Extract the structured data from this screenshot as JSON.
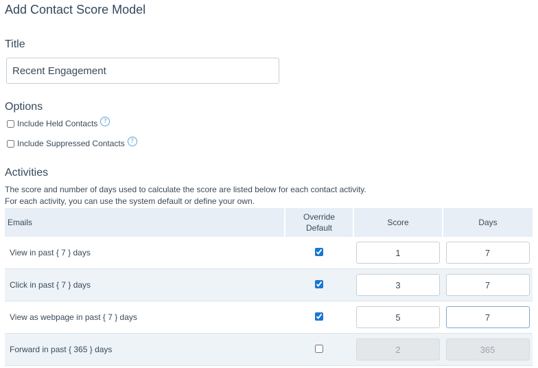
{
  "page": {
    "heading": "Add Contact Score Model"
  },
  "title_section": {
    "heading": "Title",
    "value": "Recent Engagement"
  },
  "options": {
    "heading": "Options",
    "items": [
      {
        "label": "Include Held Contacts",
        "checked": false,
        "help_icon": "question-circle-icon"
      },
      {
        "label": "Include Suppressed Contacts",
        "checked": false,
        "help_icon": "question-circle-icon"
      }
    ]
  },
  "activities": {
    "heading": "Activities",
    "description_1": "The score and number of days used to calculate the score are listed below for each contact activity.",
    "description_2": "For each activity, you can use the system default or define your own.",
    "table": {
      "headers": {
        "emails": "Emails",
        "override_line1": "Override",
        "override_line2": "Default",
        "score": "Score",
        "days": "Days"
      },
      "rows": [
        {
          "label": "View in past { 7 } days",
          "override": true,
          "score": "1",
          "days": "7",
          "disabled": false
        },
        {
          "label": "Click in past { 7 } days",
          "override": true,
          "score": "3",
          "days": "7",
          "disabled": false
        },
        {
          "label": "View as webpage in past { 7 } days",
          "override": true,
          "score": "5",
          "days": "7",
          "disabled": false
        },
        {
          "label": "Forward in past { 365 } days",
          "override": false,
          "score": "2",
          "days": "365",
          "disabled": true
        }
      ]
    }
  },
  "colors": {
    "header_bg": "#e7eef5",
    "row_shade": "#eef3f8",
    "accent": "#1976d2",
    "heading_text": "#34485c"
  }
}
